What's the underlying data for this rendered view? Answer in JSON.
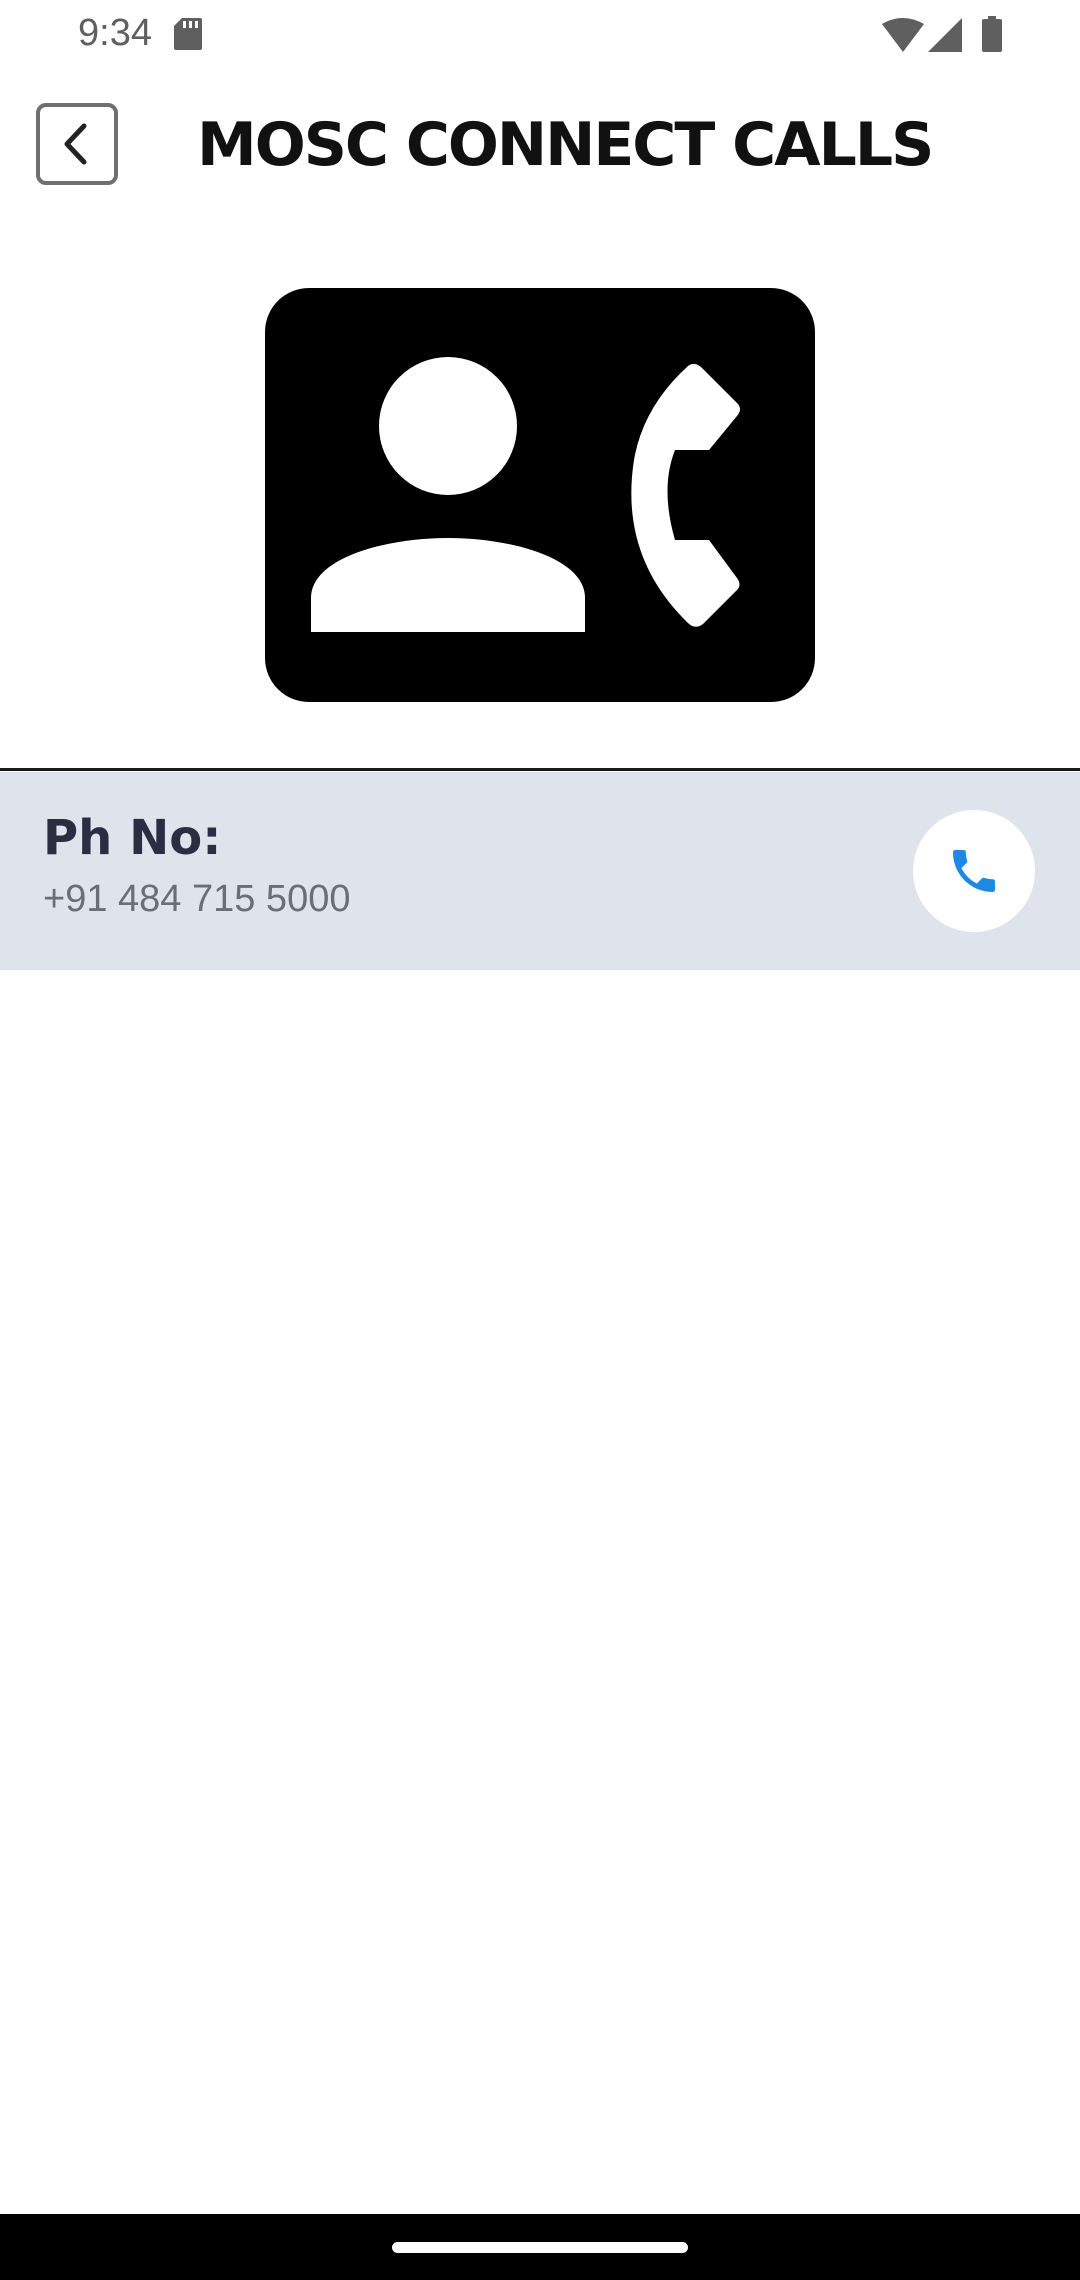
{
  "status_bar": {
    "time": "9:34",
    "icons": [
      "sd-card-icon",
      "wifi-icon",
      "signal-icon",
      "battery-icon"
    ]
  },
  "app_bar": {
    "back_icon": "chevron-left-icon",
    "title": "MOSC CONNECT CALLS"
  },
  "hero": {
    "icon": "contact-phone-icon"
  },
  "phone_row": {
    "label": "Ph No:",
    "number": "+91 484 715 5000",
    "call_icon": "phone-icon",
    "call_icon_color": "#1e88e5"
  },
  "colors": {
    "row_background": "#dfe3eb",
    "title": "#111111",
    "label": "#2b2d42"
  }
}
